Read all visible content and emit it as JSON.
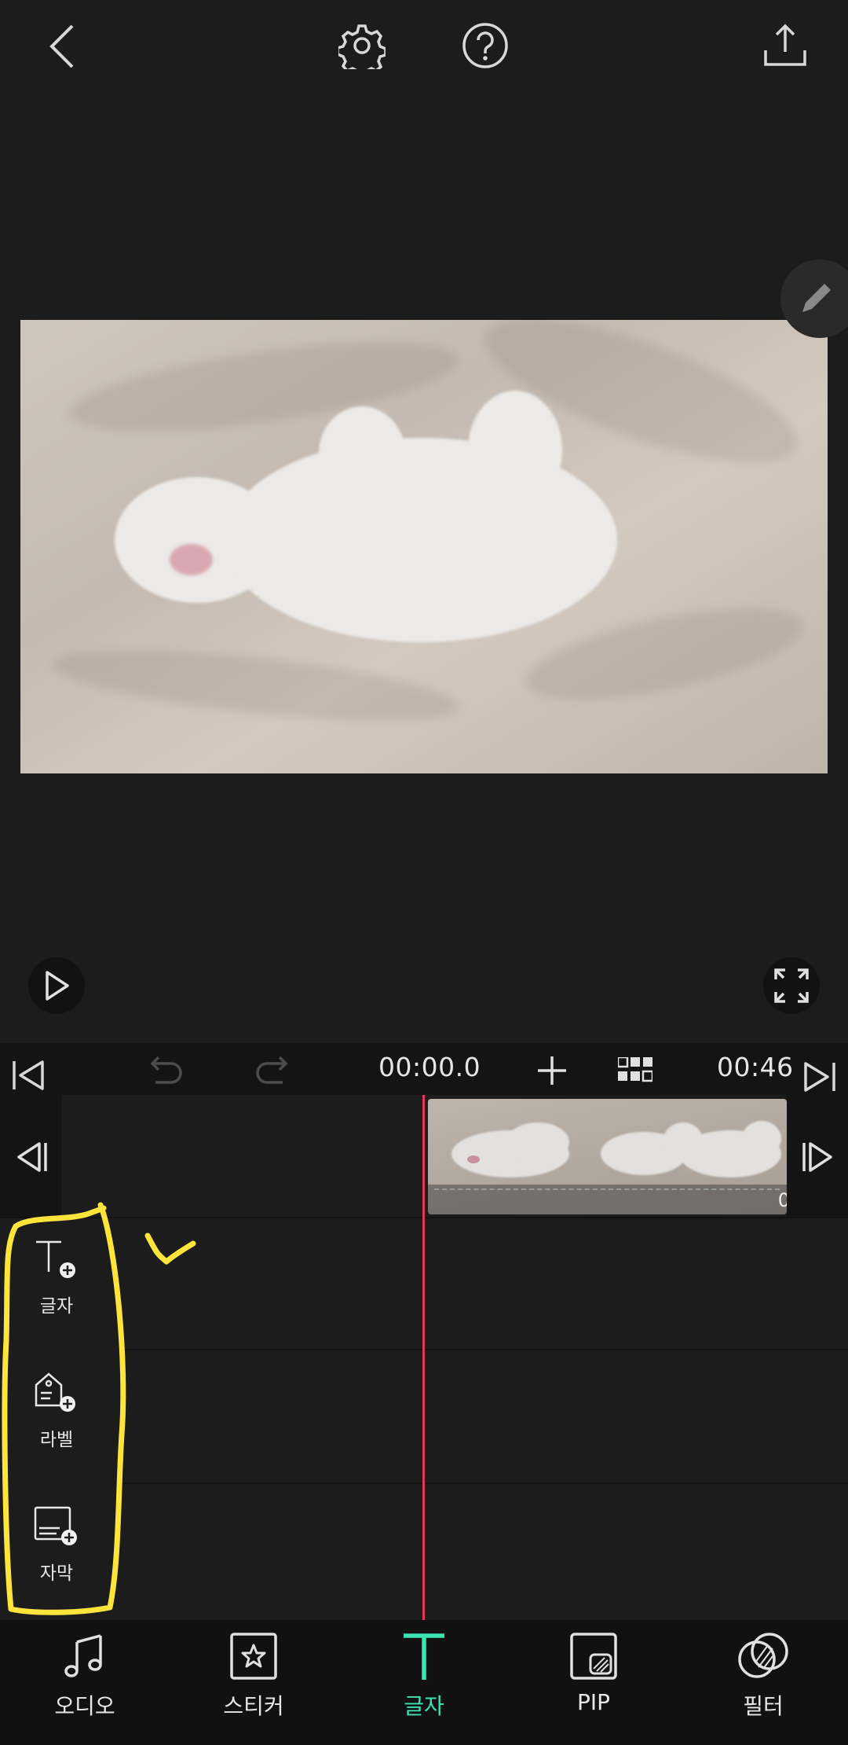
{
  "timeline": {
    "current_time": "00:00.0",
    "duration": "00:46",
    "clip_overflow_digit": "0"
  },
  "text_tools": [
    {
      "label": "글자",
      "icon": "text-add-icon"
    },
    {
      "label": "라벨",
      "icon": "label-add-icon"
    },
    {
      "label": "자막",
      "icon": "subtitle-add-icon"
    }
  ],
  "bottom_nav": [
    {
      "label": "오디오",
      "icon": "music-note-icon"
    },
    {
      "label": "스티커",
      "icon": "sticker-star-icon"
    },
    {
      "label": "글자",
      "icon": "text-t-icon",
      "active": true
    },
    {
      "label": "PIP",
      "icon": "pip-icon"
    },
    {
      "label": "필터",
      "icon": "filter-icon"
    }
  ],
  "colors": {
    "background": "#1c1c1d",
    "accent": "#3de3b2",
    "playhead": "#e8335c",
    "annotation": "#ffe53b"
  }
}
